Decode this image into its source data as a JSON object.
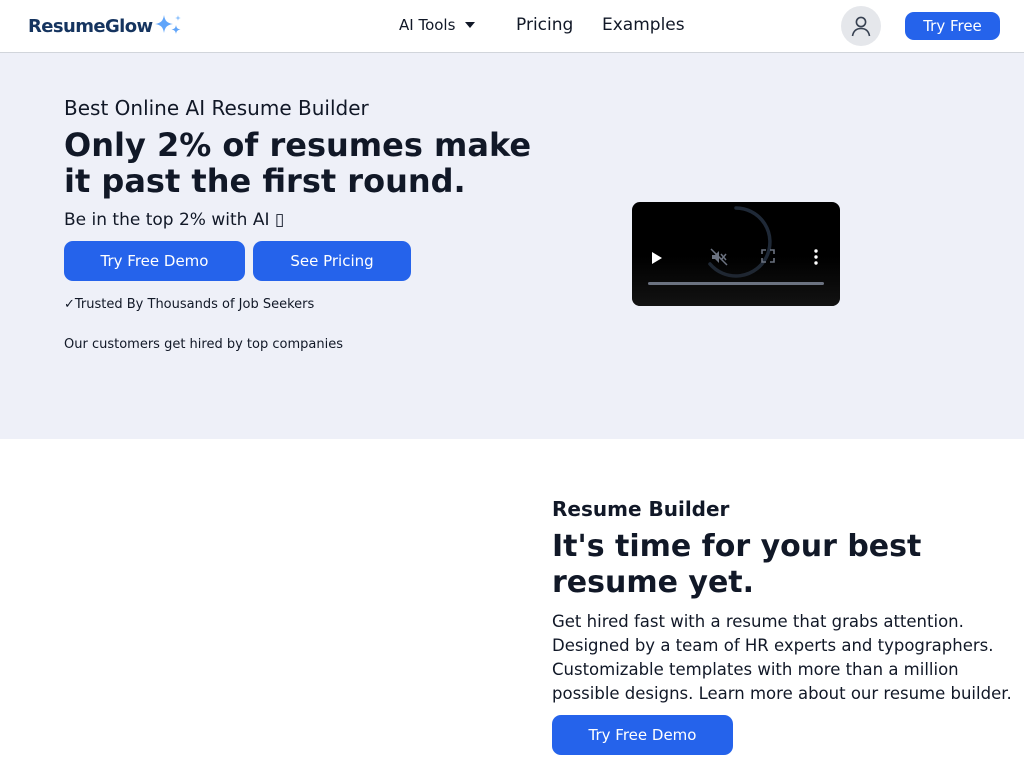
{
  "header": {
    "logo_text": "ResumeGlow",
    "logo_icon": "sparkle-icon",
    "nav": {
      "ai_tools_label": "AI Tools",
      "pricing_label": "Pricing",
      "examples_label": "Examples"
    },
    "avatar_icon": "user-icon",
    "try_free_label": "Try Free"
  },
  "hero": {
    "eyebrow": "Best Online AI Resume Builder",
    "title": "Only 2% of resumes make it past the first round.",
    "subtitle": "Be in the top 2% with AI ▯",
    "demo_button": "Try Free Demo",
    "pricing_button": "See Pricing",
    "trusted": "✓Trusted By Thousands of Job Seekers",
    "customers": "Our customers get hired by top companies"
  },
  "video": {
    "controls": [
      "play-icon",
      "mute-icon",
      "fullscreen-icon",
      "more-options-icon"
    ],
    "state": "loading"
  },
  "builder": {
    "kicker": "Resume Builder",
    "title": "It's time for your best resume yet.",
    "description": "Get hired fast with a resume that grabs attention. Designed by a team of HR experts and typographers. Customizable templates with more than a million possible designs. Learn more about our resume builder.",
    "demo_button": "Try Free Demo"
  },
  "colors": {
    "accent": "#2563eb",
    "logo": "#15345f",
    "sparkle": "#60a5fa",
    "hero_bg": "#eef0f8"
  }
}
